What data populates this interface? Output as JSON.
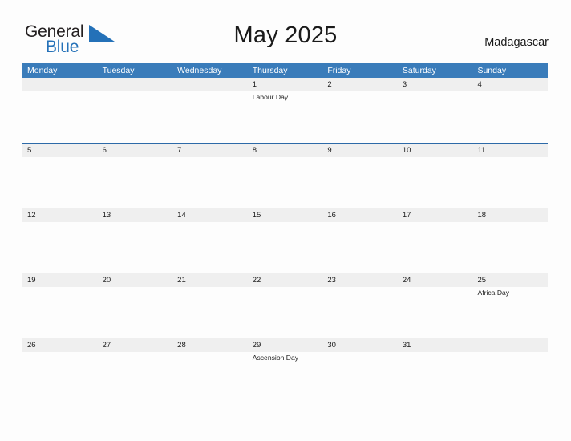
{
  "brand": {
    "name_part1": "General",
    "name_part2": "Blue",
    "flag_icon": "blue-triangle-flag-icon"
  },
  "header": {
    "title": "May 2025",
    "country": "Madagascar"
  },
  "calendar": {
    "weekdays": [
      "Monday",
      "Tuesday",
      "Wednesday",
      "Thursday",
      "Friday",
      "Saturday",
      "Sunday"
    ],
    "header_bg": "#3a7cba",
    "band_bg": "#efefef",
    "row_border": "#2d6aa8",
    "weeks": [
      {
        "days": [
          {
            "num": "",
            "event": ""
          },
          {
            "num": "",
            "event": ""
          },
          {
            "num": "",
            "event": ""
          },
          {
            "num": "1",
            "event": "Labour Day"
          },
          {
            "num": "2",
            "event": ""
          },
          {
            "num": "3",
            "event": ""
          },
          {
            "num": "4",
            "event": ""
          }
        ]
      },
      {
        "days": [
          {
            "num": "5",
            "event": ""
          },
          {
            "num": "6",
            "event": ""
          },
          {
            "num": "7",
            "event": ""
          },
          {
            "num": "8",
            "event": ""
          },
          {
            "num": "9",
            "event": ""
          },
          {
            "num": "10",
            "event": ""
          },
          {
            "num": "11",
            "event": ""
          }
        ]
      },
      {
        "days": [
          {
            "num": "12",
            "event": ""
          },
          {
            "num": "13",
            "event": ""
          },
          {
            "num": "14",
            "event": ""
          },
          {
            "num": "15",
            "event": ""
          },
          {
            "num": "16",
            "event": ""
          },
          {
            "num": "17",
            "event": ""
          },
          {
            "num": "18",
            "event": ""
          }
        ]
      },
      {
        "days": [
          {
            "num": "19",
            "event": ""
          },
          {
            "num": "20",
            "event": ""
          },
          {
            "num": "21",
            "event": ""
          },
          {
            "num": "22",
            "event": ""
          },
          {
            "num": "23",
            "event": ""
          },
          {
            "num": "24",
            "event": ""
          },
          {
            "num": "25",
            "event": "Africa Day"
          }
        ]
      },
      {
        "days": [
          {
            "num": "26",
            "event": ""
          },
          {
            "num": "27",
            "event": ""
          },
          {
            "num": "28",
            "event": ""
          },
          {
            "num": "29",
            "event": "Ascension Day"
          },
          {
            "num": "30",
            "event": ""
          },
          {
            "num": "31",
            "event": ""
          },
          {
            "num": "",
            "event": ""
          }
        ]
      }
    ]
  }
}
